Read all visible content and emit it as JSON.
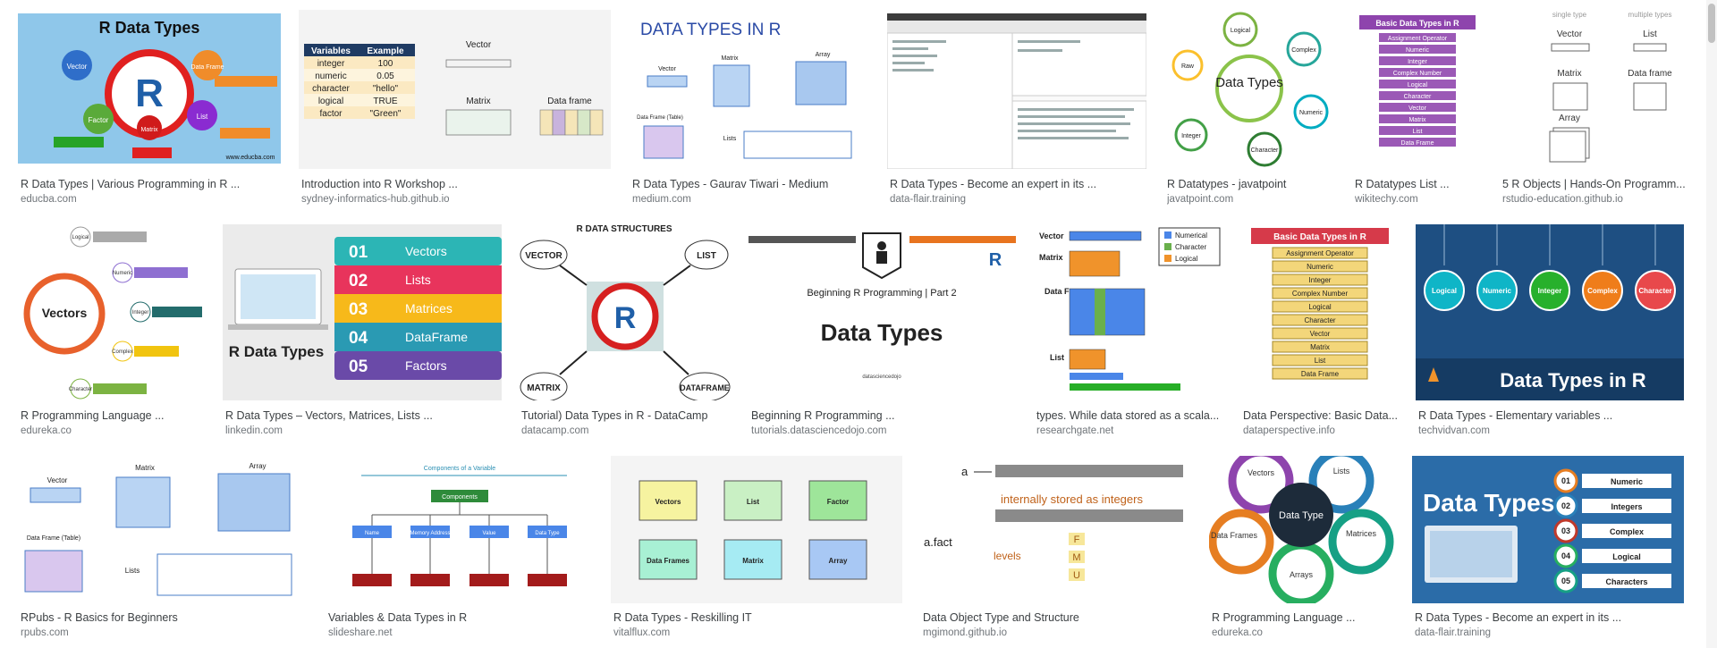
{
  "results": [
    {
      "title": "R Data Types | Various Programming in R ...",
      "source": "educba.com",
      "thumb_text": [
        "R Data Types",
        "Vector",
        "Data Frame",
        "Factor",
        "Matrix",
        "List",
        "www.educba.com"
      ]
    },
    {
      "title": "Introduction into R Workshop ...",
      "source": "sydney-informatics-hub.github.io",
      "thumb_text": [
        "Variables",
        "Example",
        "integer",
        "100",
        "numeric",
        "0.05",
        "character",
        "\"hello\"",
        "logical",
        "TRUE",
        "factor",
        "\"Green\"",
        "Vector",
        "Matrix",
        "Data frame"
      ]
    },
    {
      "title": "R Data Types - Gaurav Tiwari - Medium",
      "source": "medium.com",
      "thumb_text": [
        "DATA TYPES IN R",
        "Vector",
        "Matrix",
        "Array",
        "Data Frame (Table)",
        "Lists"
      ]
    },
    {
      "title": "R Data Types - Become an expert in its ...",
      "source": "data-flair.training",
      "thumb_text": []
    },
    {
      "title": "R Datatypes - javatpoint",
      "source": "javatpoint.com",
      "thumb_text": [
        "Data Types",
        "Logical",
        "Complex",
        "Raw",
        "Numeric",
        "Integer",
        "Character"
      ]
    },
    {
      "title": "R Datatypes List ...",
      "source": "wikitechy.com",
      "thumb_text": [
        "Basic Data Types in R",
        "Assignment Operator",
        "Numeric",
        "Integer",
        "Complex Number",
        "Logical",
        "Character",
        "Vector",
        "Matrix",
        "List",
        "Data Frame"
      ]
    },
    {
      "title": "5 R Objects | Hands-On Programm...",
      "source": "rstudio-education.github.io",
      "thumb_text": [
        "single type",
        "multiple types",
        "Vector",
        "List",
        "Matrix",
        "Data frame",
        "Array"
      ]
    },
    {
      "title": "R Programming Language ...",
      "source": "edureka.co",
      "thumb_text": [
        "Vectors",
        "Logical",
        "Numeric",
        "Integer",
        "Complex",
        "Character"
      ]
    },
    {
      "title": "R Data Types – Vectors, Matrices, Lists ...",
      "source": "linkedin.com",
      "thumb_text": [
        "R Data Types",
        "01",
        "Vectors",
        "02",
        "Lists",
        "03",
        "Matrices",
        "04",
        "DataFrame",
        "05",
        "Factors"
      ]
    },
    {
      "title": "Tutorial) Data Types in R - DataCamp",
      "source": "datacamp.com",
      "thumb_text": [
        "R DATA STRUCTURES",
        "VECTOR",
        "LIST",
        "MATRIX",
        "DATAFRAME"
      ]
    },
    {
      "title": "Beginning R Programming ...",
      "source": "tutorials.datasciencedojo.com",
      "thumb_text": [
        "Beginning R Programming | Part 2",
        "Data Types",
        "datasciencedojo"
      ]
    },
    {
      "title": "types. While data stored as a scala...",
      "source": "researchgate.net",
      "thumb_text": [
        "Vector",
        "Matrix",
        "Data Frame",
        "List",
        "Numerical",
        "Character",
        "Logical"
      ]
    },
    {
      "title": "Data Perspective: Basic Data...",
      "source": "dataperspective.info",
      "thumb_text": [
        "Basic Data Types in R",
        "Assignment Operator",
        "Numeric",
        "Integer",
        "Complex Number",
        "Logical",
        "Character",
        "Vector",
        "Matrix",
        "List",
        "Data Frame"
      ]
    },
    {
      "title": "R Data Types - Elementary variables ...",
      "source": "techvidvan.com",
      "thumb_text": [
        "Logical",
        "Numeric",
        "Integer",
        "Complex",
        "Character",
        "Data Types in R"
      ]
    },
    {
      "title": "RPubs - R Basics for Beginners",
      "source": "rpubs.com",
      "thumb_text": [
        "Vector",
        "Matrix",
        "Array",
        "Data Frame (Table)",
        "Lists"
      ]
    },
    {
      "title": "Variables & Data Types in R",
      "source": "slideshare.net",
      "thumb_text": [
        "Components of a Variable",
        "Components",
        "Name",
        "Memory Address",
        "Value",
        "Data Type"
      ]
    },
    {
      "title": "R Data Types - Reskilling IT",
      "source": "vitalflux.com",
      "thumb_text": [
        "Vectors",
        "List",
        "Factor",
        "Data Frames",
        "Matrix",
        "Array"
      ]
    },
    {
      "title": "Data Object Type and Structure",
      "source": "mgimond.github.io",
      "thumb_text": [
        "a",
        "internally stored as integers",
        "a.fact",
        "levels",
        "F",
        "M",
        "U"
      ]
    },
    {
      "title": "R Programming Language ...",
      "source": "edureka.co",
      "thumb_text": [
        "Data Type",
        "Vectors",
        "Lists",
        "Matrices",
        "Arrays",
        "Data Frames"
      ]
    },
    {
      "title": "R Data Types - Become an expert in its ...",
      "source": "data-flair.training",
      "thumb_text": [
        "Data Types",
        "01",
        "Numeric",
        "02",
        "Integers",
        "03",
        "Complex",
        "04",
        "Logical",
        "05",
        "Characters"
      ]
    }
  ]
}
